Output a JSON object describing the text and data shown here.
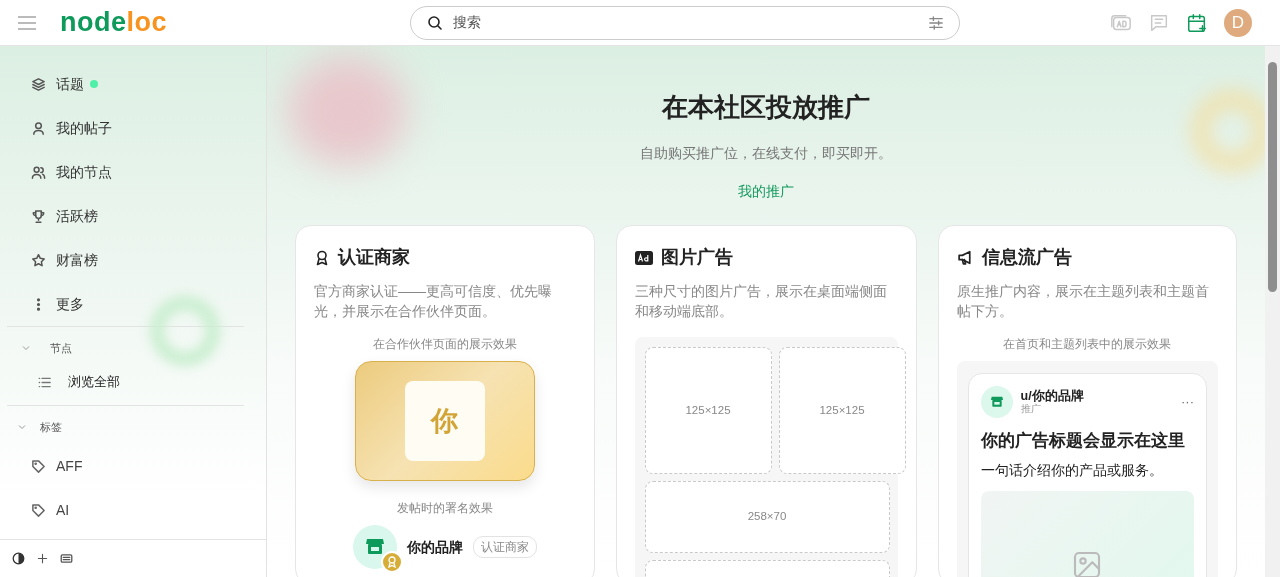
{
  "header": {
    "logo": [
      {
        "text": "node",
        "color": "#0e9a5a"
      },
      {
        "text": "loc",
        "color": "#f7931e"
      }
    ],
    "search": {
      "placeholder": "搜索"
    },
    "avatar": {
      "letter": "D",
      "color": "#deaa7e"
    }
  },
  "sidebar": {
    "items": [
      {
        "label": "话题",
        "unread": true
      },
      {
        "label": "我的帖子",
        "unread": false
      },
      {
        "label": "我的节点",
        "unread": false
      },
      {
        "label": "活跃榜",
        "unread": false
      },
      {
        "label": "财富榜",
        "unread": false
      },
      {
        "label": "更多",
        "unread": false
      }
    ],
    "sections": [
      {
        "title": "节点",
        "expanded": true,
        "items": [
          {
            "kind": "list",
            "label": "浏览全部"
          }
        ]
      },
      {
        "title": "标签",
        "expanded": true,
        "items": [
          {
            "kind": "tag",
            "label": "AFF"
          },
          {
            "kind": "tag",
            "label": "AI"
          }
        ]
      }
    ]
  },
  "hero": {
    "title": "在本社区投放推广",
    "subtitle": "自助购买推广位，在线支付，即买即开。",
    "link": "我的推广"
  },
  "cards": [
    {
      "kind": "merchant",
      "title": "认证商家",
      "description": "官方商家认证——更高可信度、优先曝光，并展示在合作伙伴页面。",
      "caption": "在合作伙伴页面的展示效果",
      "tile": "你",
      "caption_2": "发帖时的署名效果",
      "brand": "你的品牌",
      "badge": "认证商家"
    },
    {
      "kind": "image",
      "title": "图片广告",
      "description": "三种尺寸的图片广告，展示在桌面端侧面和移动端底部。",
      "slots": [
        {
          "kind": "square",
          "label": "125×125"
        },
        {
          "kind": "square",
          "label": "125×125"
        },
        {
          "kind": "wide",
          "label": "258×70"
        },
        {
          "kind": "wide"
        }
      ]
    },
    {
      "kind": "feed",
      "title": "信息流广告",
      "description": "原生推广内容，展示在主题列表和主题首帖下方。",
      "caption": "在首页和主题列表中的展示效果",
      "post": {
        "user": "u/你的品牌",
        "tag": "推广",
        "menu": "···",
        "headline": "你的广告标题会显示在这里",
        "body": "一句话介绍你的产品或服务。"
      }
    }
  ]
}
